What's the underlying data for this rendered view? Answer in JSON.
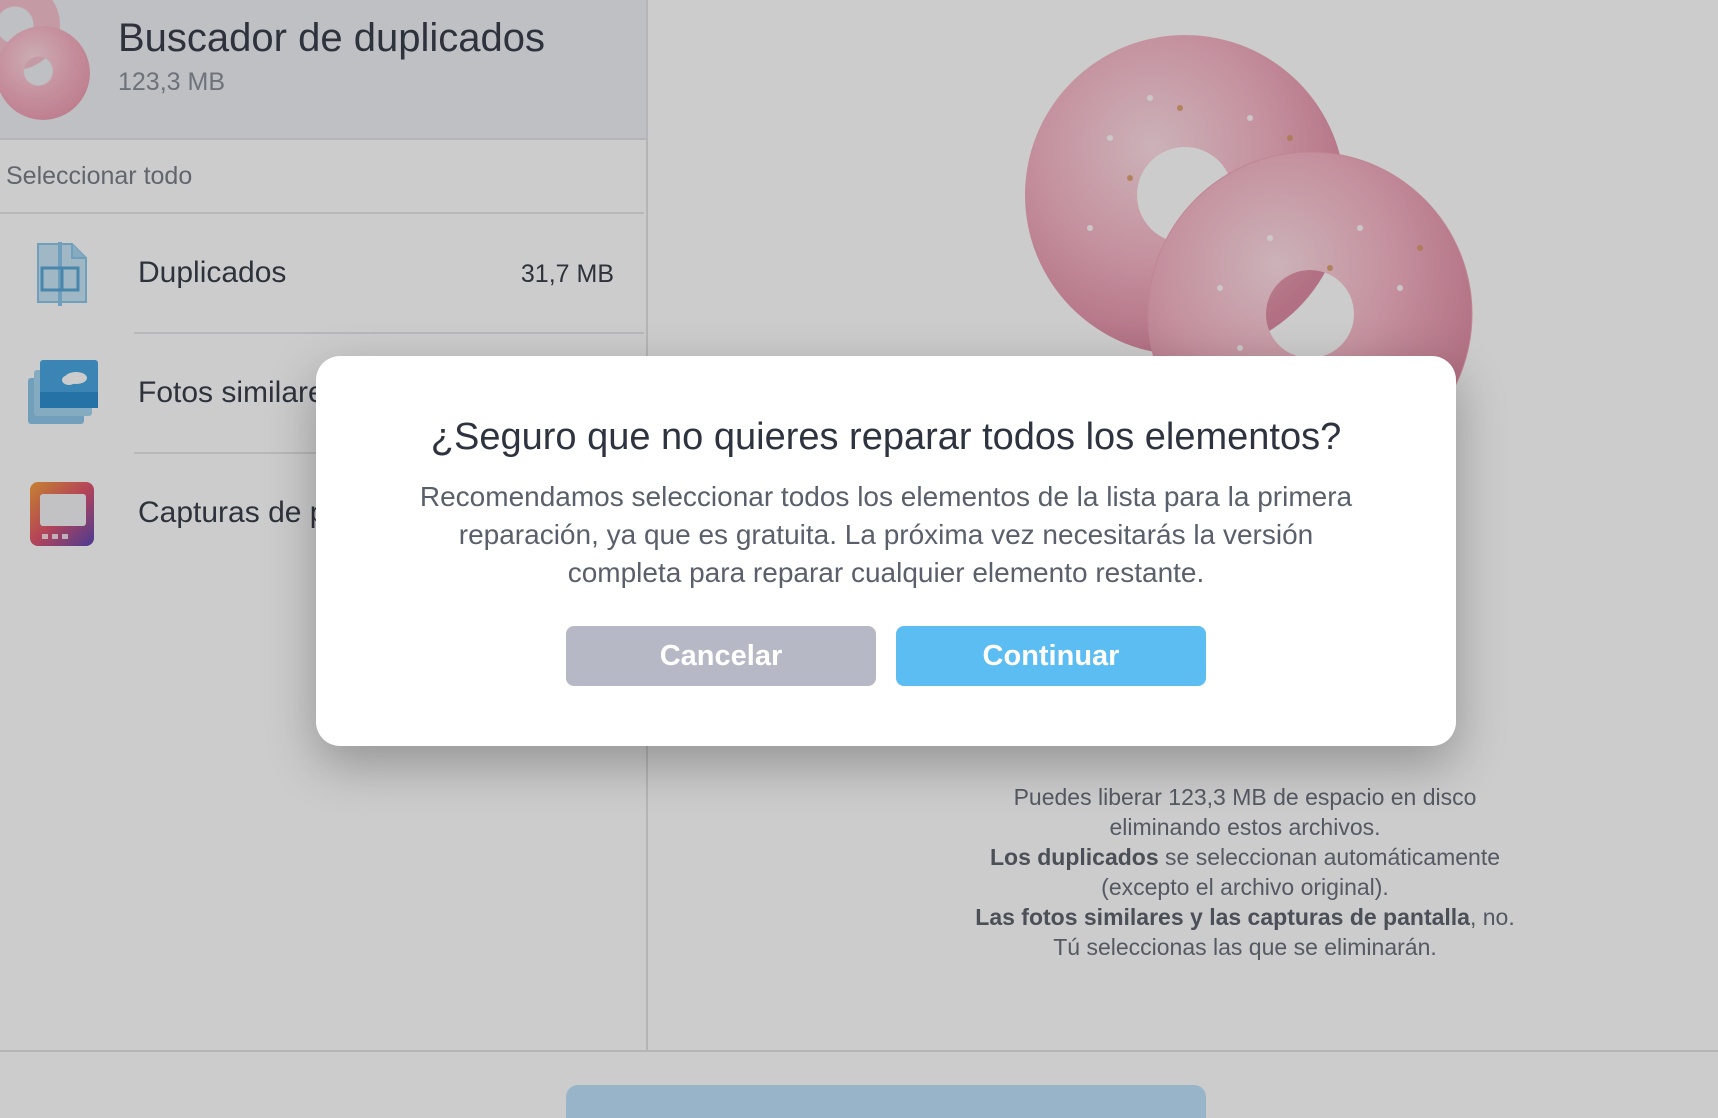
{
  "sidebar": {
    "header": {
      "title": "Buscador de duplicados",
      "size": "123,3 MB",
      "icon": "donut-icon"
    },
    "select_all_label": "Seleccionar todo",
    "items": [
      {
        "label": "Duplicados",
        "size": "31,7 MB",
        "icon": "duplicate-files-icon"
      },
      {
        "label": "Fotos similares",
        "size": "",
        "icon": "photos-icon"
      },
      {
        "label": "Capturas de pantalla",
        "size": "",
        "icon": "screenshot-icon"
      }
    ]
  },
  "main": {
    "illustration": "donuts-illustration",
    "info": {
      "line1": "Puedes liberar 123,3 MB de espacio en disco",
      "line2": "eliminando estos archivos.",
      "line3_bold": "Los duplicados",
      "line3_rest": " se seleccionan automáticamente",
      "line4": "(excepto el archivo original).",
      "line5_bold": "Las fotos similares y las capturas de pantalla",
      "line5_rest": ", no.",
      "line6": "Tú seleccionas las que se eliminarán."
    }
  },
  "dialog": {
    "title": "¿Seguro que no quieres reparar todos los elementos?",
    "message": "Recomendamos seleccionar todos los elementos de la lista para la primera reparación, ya que es gratuita. La próxima vez necesitarás la versión completa para reparar cualquier elemento restante.",
    "cancel_label": "Cancelar",
    "continue_label": "Continuar"
  },
  "colors": {
    "accent": "#5bbdf2",
    "cancel": "#b6b8c6",
    "donut_pink": "#f3b4c4",
    "overlay": "rgba(0,0,0,0.2)"
  }
}
